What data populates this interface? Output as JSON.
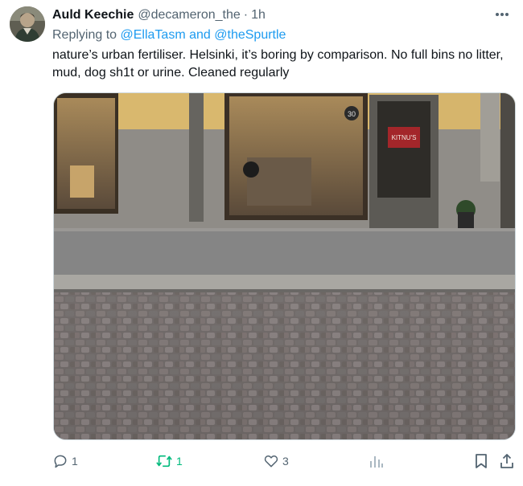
{
  "tweet": {
    "display_name": "Auld Keechie",
    "handle": "@decameron_the",
    "separator": "·",
    "time": "1h",
    "replying_to_prefix": "Replying to",
    "replying_to_user1": "@EllaTasm",
    "replying_to_and": "and",
    "replying_to_user2": "@theSpurtle",
    "text": "nature’s urban fertiliser. Helsinki, it’s boring by comparison. No full bins no litter, mud, dog sh1t or urine. Cleaned regularly",
    "media": {
      "sign_text": "KITNU'S",
      "window_badge": "30"
    },
    "actions": {
      "replies": "1",
      "retweets": "1",
      "likes": "3"
    }
  },
  "icons": {
    "more": "more-dots-icon",
    "reply": "reply-bubble-icon",
    "retweet": "retweet-arrows-icon",
    "like": "heart-icon",
    "views": "views-bars-icon",
    "bookmark": "bookmark-icon",
    "share": "share-upload-icon"
  },
  "colors": {
    "link": "#1d9bf0",
    "secondary_text": "#536471",
    "retweet_active": "#00ba7c",
    "primary_text": "#0f1419"
  }
}
